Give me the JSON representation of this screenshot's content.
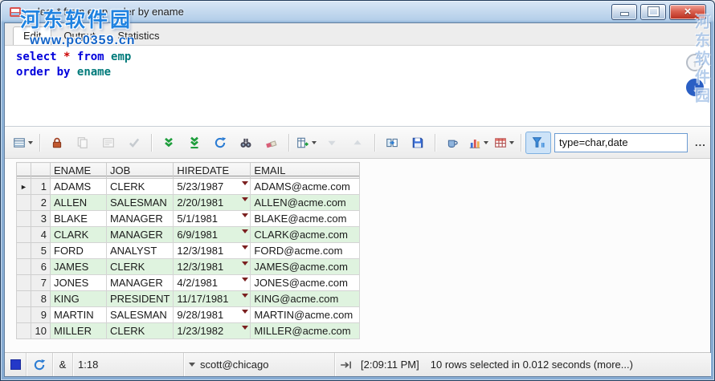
{
  "window": {
    "title": "select * from emp order by ename",
    "close_glyph": "×"
  },
  "watermark": {
    "name": "河东软件园",
    "url": "www.pc0359.cn"
  },
  "tabs": [
    {
      "label": "Edit",
      "active": true
    },
    {
      "label": "Output",
      "active": false
    },
    {
      "label": "Statistics",
      "active": false
    }
  ],
  "editor": {
    "lines": [
      [
        {
          "text": "select",
          "type": "keyword"
        },
        {
          "text": " ",
          "type": "plain"
        },
        {
          "text": "*",
          "type": "operator"
        },
        {
          "text": " ",
          "type": "plain"
        },
        {
          "text": "from",
          "type": "keyword"
        },
        {
          "text": " ",
          "type": "plain"
        },
        {
          "text": "emp",
          "type": "identifier"
        }
      ],
      [
        {
          "text": "order",
          "type": "keyword"
        },
        {
          "text": " ",
          "type": "plain"
        },
        {
          "text": "by",
          "type": "keyword"
        },
        {
          "text": " ",
          "type": "plain"
        },
        {
          "text": "ename",
          "type": "identifier"
        }
      ]
    ],
    "scroll_up_glyph": "↑",
    "scroll_down_glyph": "↓"
  },
  "toolbar": {
    "buttons": [
      {
        "name": "grid-options-button",
        "icon": "grid-menu",
        "dropdown": true
      },
      {
        "name": "lock-button",
        "icon": "lock",
        "sep_before": true
      },
      {
        "name": "copy-button",
        "icon": "copy",
        "disabled": true
      },
      {
        "name": "record-view-button",
        "icon": "record",
        "disabled": true
      },
      {
        "name": "post-edit-button",
        "icon": "check",
        "disabled": true
      },
      {
        "name": "fetch-next-button",
        "icon": "double-down",
        "sep_before": true
      },
      {
        "name": "fetch-all-button",
        "icon": "double-down-line"
      },
      {
        "name": "refresh-button",
        "icon": "refresh"
      },
      {
        "name": "find-button",
        "icon": "binoculars"
      },
      {
        "name": "erase-button",
        "icon": "eraser"
      },
      {
        "name": "export-button",
        "icon": "export",
        "dropdown": true,
        "sep_before": true
      },
      {
        "name": "sort-desc-button",
        "icon": "tri-down",
        "disabled": true
      },
      {
        "name": "sort-asc-button",
        "icon": "tri-up",
        "disabled": true
      },
      {
        "name": "transpose-button",
        "icon": "transpose",
        "sep_before": true
      },
      {
        "name": "save-button",
        "icon": "save"
      },
      {
        "name": "cup-button",
        "icon": "cup",
        "sep_before": true
      },
      {
        "name": "chart-button",
        "icon": "chart",
        "dropdown": true
      },
      {
        "name": "format-grid-button",
        "icon": "table",
        "dropdown": true
      },
      {
        "name": "filter-toggle-button",
        "icon": "funnel",
        "active": true,
        "sep_before": true
      }
    ],
    "filter_value": "type=char,date",
    "more_label": "..."
  },
  "grid": {
    "columns": [
      {
        "key": "ename",
        "label": "ENAME"
      },
      {
        "key": "job",
        "label": "JOB"
      },
      {
        "key": "hiredate",
        "label": "HIREDATE",
        "has_dropdown": true
      },
      {
        "key": "email",
        "label": "EMAIL"
      }
    ],
    "rows": [
      {
        "num": "1",
        "ename": "ADAMS",
        "job": "CLERK",
        "hiredate": "5/23/1987",
        "email": "ADAMS@acme.com",
        "selected": true
      },
      {
        "num": "2",
        "ename": "ALLEN",
        "job": "SALESMAN",
        "hiredate": "2/20/1981",
        "email": "ALLEN@acme.com"
      },
      {
        "num": "3",
        "ename": "BLAKE",
        "job": "MANAGER",
        "hiredate": "5/1/1981",
        "email": "BLAKE@acme.com"
      },
      {
        "num": "4",
        "ename": "CLARK",
        "job": "MANAGER",
        "hiredate": "6/9/1981",
        "email": "CLARK@acme.com"
      },
      {
        "num": "5",
        "ename": "FORD",
        "job": "ANALYST",
        "hiredate": "12/3/1981",
        "email": "FORD@acme.com"
      },
      {
        "num": "6",
        "ename": "JAMES",
        "job": "CLERK",
        "hiredate": "12/3/1981",
        "email": "JAMES@acme.com"
      },
      {
        "num": "7",
        "ename": "JONES",
        "job": "MANAGER",
        "hiredate": "4/2/1981",
        "email": "JONES@acme.com"
      },
      {
        "num": "8",
        "ename": "KING",
        "job": "PRESIDENT",
        "hiredate": "11/17/1981",
        "email": "KING@acme.com"
      },
      {
        "num": "9",
        "ename": "MARTIN",
        "job": "SALESMAN",
        "hiredate": "9/28/1981",
        "email": "MARTIN@acme.com"
      },
      {
        "num": "10",
        "ename": "MILLER",
        "job": "CLERK",
        "hiredate": "1/23/1982",
        "email": "MILLER@acme.com"
      }
    ],
    "selected_marker": "►"
  },
  "statusbar": {
    "ampersand": "&",
    "cursor_position": "1:18",
    "connection": "scott@chicago",
    "time": "[2:09:11 PM]",
    "rows_message": "10 rows selected in 0.012 seconds (more...)"
  },
  "colors": {
    "keyword_blue": "#0000dc",
    "identifier_teal": "#007a7a",
    "operator_red": "#cc0000",
    "row_alt_green": "#dff3df",
    "filter_active_bg": "#cde3f8",
    "titlebar_blue": "#b4cfe9",
    "status_square_blue": "#2438c8"
  }
}
